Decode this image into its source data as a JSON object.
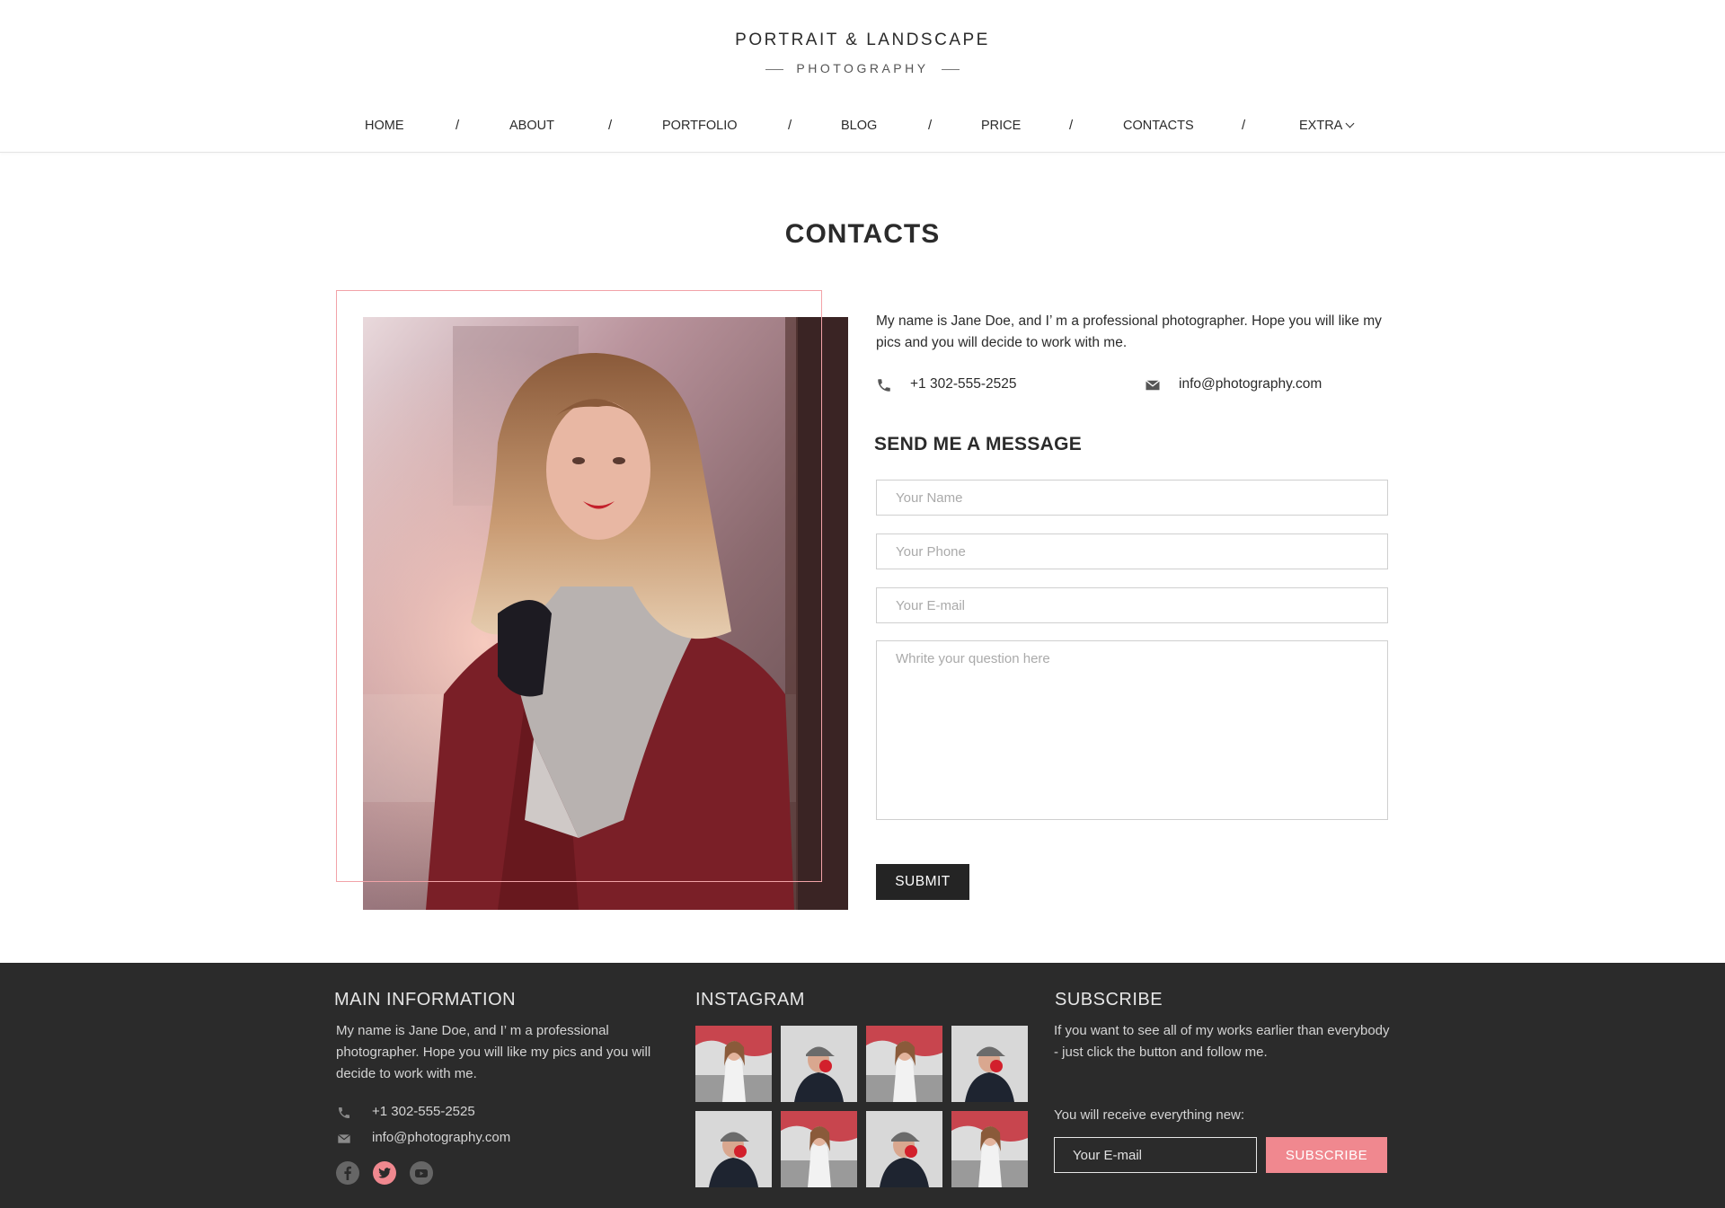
{
  "header": {
    "title": "PORTRAIT & LANDSCAPE",
    "subtitle": "PHOTOGRAPHY"
  },
  "nav": {
    "items": [
      {
        "label": "HOME"
      },
      {
        "label": "ABOUT"
      },
      {
        "label": "PORTFOLIO"
      },
      {
        "label": "BLOG"
      },
      {
        "label": "PRICE"
      },
      {
        "label": "CONTACTS"
      },
      {
        "label": "EXTRA"
      }
    ],
    "separator": "/"
  },
  "contacts": {
    "title": "CONTACTS",
    "intro": "My name is Jane Doe, and I’  m a professional photographer. Hope you will like my pics and you will decide to work with me.",
    "phone": "+1 302-555-2525",
    "email": "info@photography.com",
    "form": {
      "title": "SEND ME A MESSAGE",
      "name_placeholder": "Your Name",
      "phone_placeholder": "Your Phone",
      "email_placeholder": "Your E-mail",
      "question_placeholder": "Whrite your question here",
      "submit_label": "SUBMIT"
    }
  },
  "footer": {
    "main_info": {
      "title": "MAIN INFORMATION",
      "text": "My name is Jane Doe, and I’  m a professional photographer. Hope you will like my pics and you will decide to work with me.",
      "phone": "+1 302-555-2525",
      "email": "info@photography.com",
      "social": [
        "facebook-icon",
        "twitter-icon",
        "youtube-icon"
      ]
    },
    "instagram": {
      "title": "INSTAGRAM",
      "thumbnails": [
        "girl-red-bg",
        "man-cap",
        "girl-red-bg",
        "man-cap",
        "man-cap",
        "girl-red-bg",
        "man-cap",
        "girl-red-bg"
      ]
    },
    "subscribe": {
      "title": "SUBSCRIBE",
      "text": "If you want to see all of my works earlier than everybody - just click the button and follow me.",
      "note": "You will receive everything new:",
      "email_placeholder": "Your E-mail",
      "button_label": "SUBSCRIBE"
    }
  },
  "colors": {
    "accent": "#f0888f",
    "frame": "#f2a3a8",
    "dark": "#2b2b2b",
    "button_dark": "#242424"
  }
}
